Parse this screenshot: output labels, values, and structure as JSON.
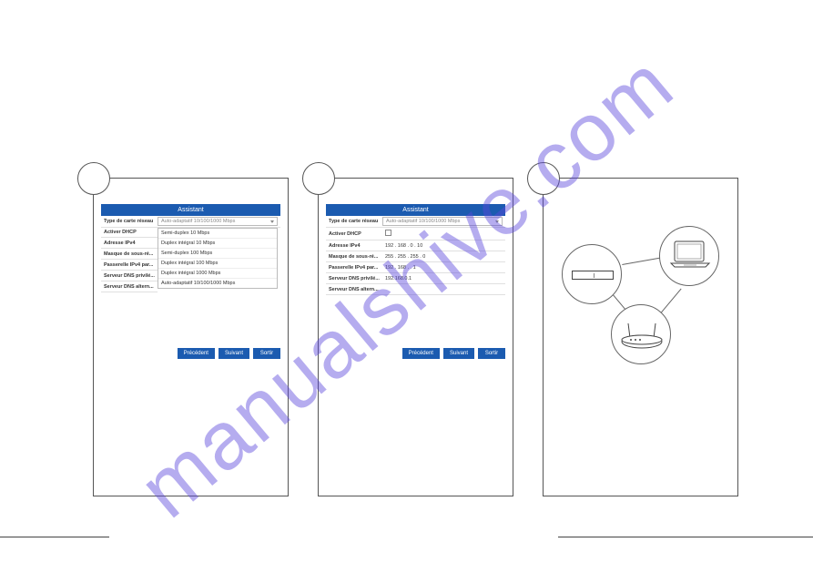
{
  "watermark": "manualshive.com",
  "panel1": {
    "title": "Assistant",
    "rows": [
      {
        "label": "Type de carte réseau",
        "value": "Auto-adaptatif 10/100/1000 Mbps",
        "select": true
      }
    ],
    "dropdown": [
      "Semi-duplex 10 Mbps",
      "Duplex intégral 10 Mbps",
      "Semi-duplex 100 Mbps",
      "Duplex intégral 100 Mbps",
      "Duplex intégral 1000 Mbps",
      "Auto-adaptatif 10/100/1000 Mbps"
    ],
    "hidden_rows": [
      {
        "label": "Activer DHCP"
      },
      {
        "label": "Adresse IPv4"
      },
      {
        "label": "Masque de sous-ré..."
      },
      {
        "label": "Passerelle IPv4 par..."
      },
      {
        "label": "Serveur DNS privilé..."
      },
      {
        "label": "Serveur DNS altern..."
      }
    ],
    "buttons": {
      "prev": "Précédent",
      "next": "Suivant",
      "exit": "Sortir"
    }
  },
  "panel2": {
    "title": "Assistant",
    "rows": [
      {
        "label": "Type de carte réseau",
        "value": "Auto-adaptatif 10/100/1000 Mbps",
        "select": true
      },
      {
        "label": "Activer DHCP",
        "checkbox": true
      },
      {
        "label": "Adresse IPv4",
        "value": "192 . 168 . 0  .  10"
      },
      {
        "label": "Masque de sous-ré...",
        "value": "255 . 255 . 255 . 0"
      },
      {
        "label": "Passerelle IPv4 par...",
        "value": "192 . 168 .  .  1"
      },
      {
        "label": "Serveur DNS privilé...",
        "value": "192.168.0.1"
      },
      {
        "label": "Serveur DNS altern...",
        "value": ""
      }
    ],
    "buttons": {
      "prev": "Précédent",
      "next": "Suivant",
      "exit": "Sortir"
    }
  },
  "panel3": {
    "devices": {
      "nvr": "nvr-device",
      "laptop": "laptop",
      "router": "wifi-router"
    }
  }
}
